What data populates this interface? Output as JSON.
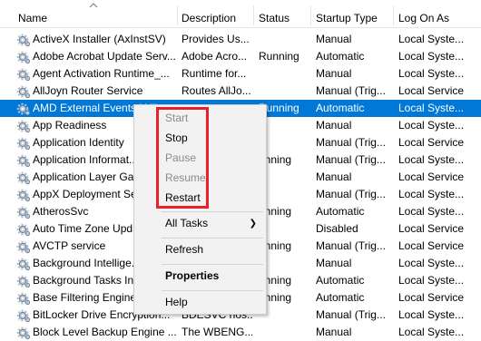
{
  "columns": {
    "name": "Name",
    "description": "Description",
    "status": "Status",
    "startup_type": "Startup Type",
    "log_on_as": "Log On As"
  },
  "services": [
    {
      "name": "ActiveX Installer (AxInstSV)",
      "description": "Provides Us...",
      "status": "",
      "startup_type": "Manual",
      "log_on_as": "Local Syste..."
    },
    {
      "name": "Adobe Acrobat Update Serv...",
      "description": "Adobe Acro...",
      "status": "Running",
      "startup_type": "Automatic",
      "log_on_as": "Local Syste..."
    },
    {
      "name": "Agent Activation Runtime_...",
      "description": "Runtime for...",
      "status": "",
      "startup_type": "Manual",
      "log_on_as": "Local Syste..."
    },
    {
      "name": "AllJoyn Router Service",
      "description": "Routes AllJo...",
      "status": "",
      "startup_type": "Manual (Trig...",
      "log_on_as": "Local Service"
    },
    {
      "name": "AMD External Events Utili...",
      "description": "",
      "status": "Running",
      "startup_type": "Automatic",
      "log_on_as": "Local Syste...",
      "selected": true
    },
    {
      "name": "App Readiness",
      "description": "",
      "status": "",
      "startup_type": "Manual",
      "log_on_as": "Local Syste..."
    },
    {
      "name": "Application Identity",
      "description": "",
      "status": "",
      "startup_type": "Manual (Trig...",
      "log_on_as": "Local Service"
    },
    {
      "name": "Application Informat...",
      "description": "",
      "status": "unning",
      "startup_type": "Manual (Trig...",
      "log_on_as": "Local Syste..."
    },
    {
      "name": "Application Layer Gat...",
      "description": "",
      "status": "",
      "startup_type": "Manual",
      "log_on_as": "Local Service"
    },
    {
      "name": "AppX Deployment Se...",
      "description": "",
      "status": "",
      "startup_type": "Manual (Trig...",
      "log_on_as": "Local Syste..."
    },
    {
      "name": "AtherosSvc",
      "description": "",
      "status": "unning",
      "startup_type": "Automatic",
      "log_on_as": "Local Syste..."
    },
    {
      "name": "Auto Time Zone Upd...",
      "description": "",
      "status": "",
      "startup_type": "Disabled",
      "log_on_as": "Local Service"
    },
    {
      "name": "AVCTP service",
      "description": "",
      "status": "unning",
      "startup_type": "Manual (Trig...",
      "log_on_as": "Local Service"
    },
    {
      "name": "Background Intellige...",
      "description": "",
      "status": "",
      "startup_type": "Manual",
      "log_on_as": "Local Syste..."
    },
    {
      "name": "Background Tasks Inf...",
      "description": "",
      "status": "unning",
      "startup_type": "Automatic",
      "log_on_as": "Local Syste..."
    },
    {
      "name": "Base Filtering Engine",
      "description": "",
      "status": "unning",
      "startup_type": "Automatic",
      "log_on_as": "Local Service"
    },
    {
      "name": "BitLocker Drive Encryption...",
      "description": "BDESVC hos...",
      "status": "",
      "startup_type": "Manual (Trig...",
      "log_on_as": "Local Syste..."
    },
    {
      "name": "Block Level Backup Engine ...",
      "description": "The WBENG...",
      "status": "",
      "startup_type": "Manual",
      "log_on_as": "Local Syste..."
    }
  ],
  "context_menu": {
    "start": "Start",
    "stop": "Stop",
    "pause": "Pause",
    "resume": "Resume",
    "restart": "Restart",
    "all_tasks": "All Tasks",
    "refresh": "Refresh",
    "properties": "Properties",
    "help": "Help"
  },
  "colors": {
    "selection": "#0078d7",
    "highlight_box": "#e8202a",
    "menu_background": "#f2f2f2"
  },
  "icons": {
    "service": "gear-icon",
    "submenu": "chevron-right-icon",
    "sort": "sort-up-icon"
  }
}
